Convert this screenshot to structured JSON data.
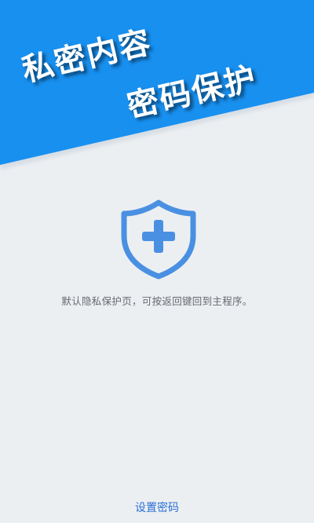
{
  "hero": {
    "line1": "私密内容",
    "line2": "密码保护"
  },
  "shield_icon": "shield-plus-icon",
  "hint": "默认隐私保护页，可按返回键回到主程序。",
  "actions": {
    "set_password_label": "设置密码"
  },
  "colors": {
    "accent": "#1890f0",
    "background": "#eceff2",
    "icon": "#4a90e2",
    "link": "#2a6fd6",
    "hint_text": "#666a70"
  }
}
